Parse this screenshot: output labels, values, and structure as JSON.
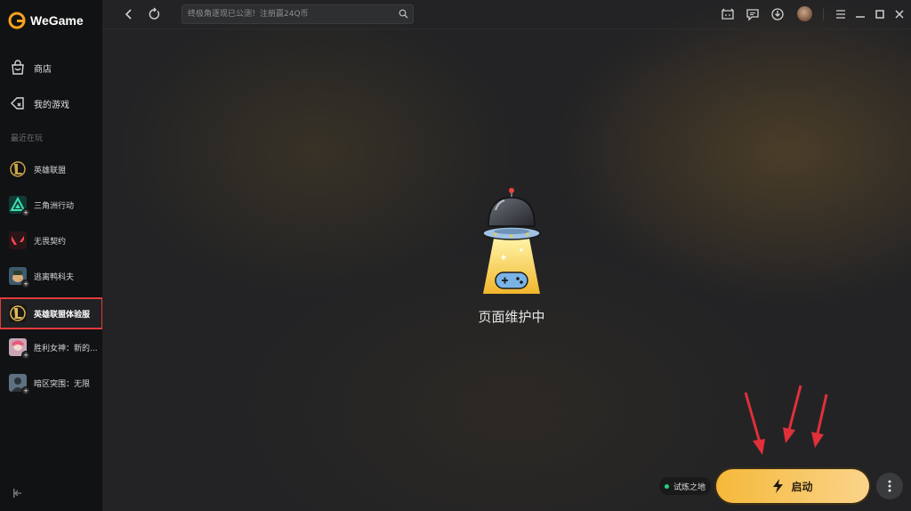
{
  "app": {
    "logo_text": "WeGame"
  },
  "sidebar": {
    "nav": [
      {
        "label": "商店",
        "icon": "shopping-bag-icon"
      },
      {
        "label": "我的游戏",
        "icon": "controller-tag-icon"
      }
    ],
    "recent_title": "最近在玩",
    "games": [
      {
        "label": "英雄联盟",
        "icon": "league-logo-icon",
        "selected": false,
        "has_badge": false
      },
      {
        "label": "三角洲行动",
        "icon": "delta-force-icon",
        "selected": false,
        "has_badge": true
      },
      {
        "label": "无畏契约",
        "icon": "valorant-icon",
        "selected": false,
        "has_badge": false
      },
      {
        "label": "逃离鸭科夫",
        "icon": "duck-character-icon",
        "selected": false,
        "has_badge": true
      },
      {
        "label": "英雄联盟体验服",
        "icon": "league-logo-icon",
        "selected": true,
        "has_badge": false
      },
      {
        "label": "胜利女神：新的...",
        "icon": "nikke-character-icon",
        "selected": false,
        "has_badge": true
      },
      {
        "label": "暗区突围：无限",
        "icon": "soldier-icon",
        "selected": false,
        "has_badge": true
      }
    ]
  },
  "topbar": {
    "search_placeholder": "终极角逐现已公测！注册赢24Q币"
  },
  "main": {
    "maintenance_text": "页面维护中",
    "zone_label": "试炼之地",
    "launch_label": "启动"
  },
  "colors": {
    "accent": "#f5b83a",
    "selection_outline": "#e23b3b",
    "annotation_arrow": "#e0303a",
    "zone_dot": "#27d07a"
  }
}
